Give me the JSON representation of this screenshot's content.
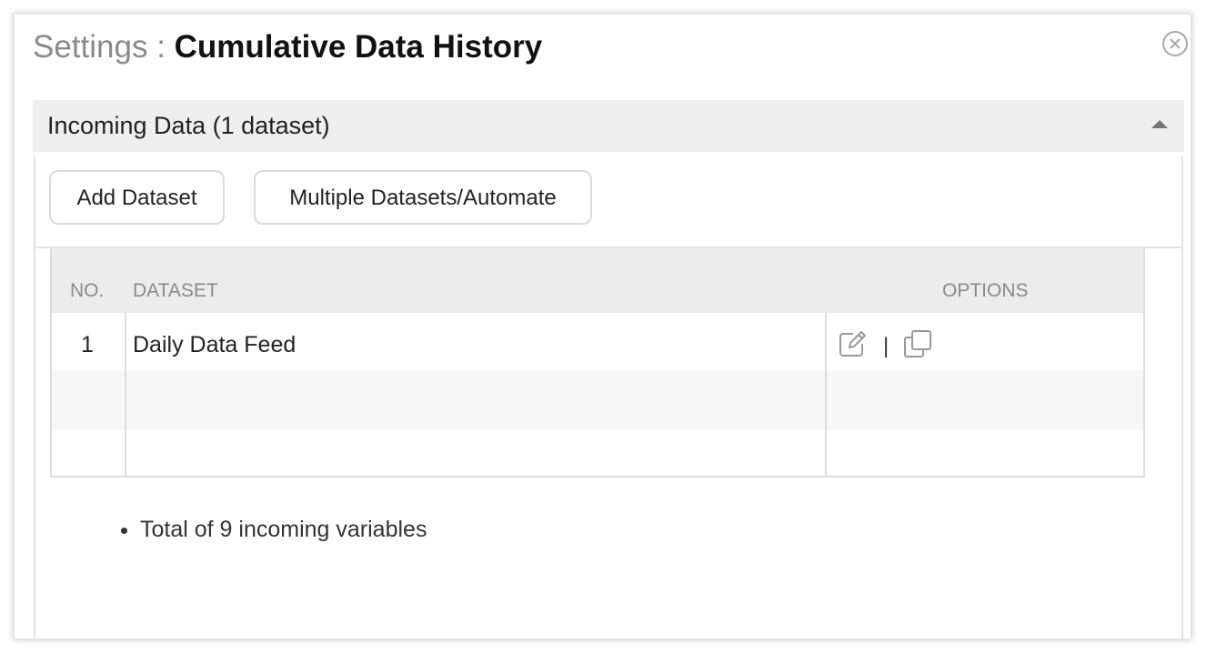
{
  "dialog": {
    "title_prefix": "Settings : ",
    "title_name": "Cumulative Data History"
  },
  "section": {
    "title": "Incoming Data (1 dataset)"
  },
  "buttons": {
    "add_dataset": "Add Dataset",
    "multiple": "Multiple Datasets/Automate"
  },
  "table": {
    "headers": {
      "no": "NO.",
      "dataset": "DATASET",
      "options": "OPTIONS"
    },
    "rows": [
      {
        "no": "1",
        "dataset": "Daily Data Feed",
        "separator": "|"
      }
    ]
  },
  "summary": {
    "items": [
      "Total of 9 incoming variables"
    ]
  },
  "icons": {
    "close": "close-icon",
    "collapse": "caret-up-icon",
    "edit": "edit-icon",
    "copy": "copy-icon"
  }
}
